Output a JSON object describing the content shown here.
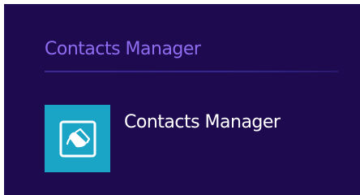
{
  "group": {
    "header": "Contacts Manager"
  },
  "apps": [
    {
      "label": "Contacts Manager",
      "icon": "contacts-manager-icon",
      "tile_color": "#1aa4c6"
    }
  ],
  "colors": {
    "background": "#1e0a4f",
    "header_text": "#8f6cf0",
    "app_text": "#ffffff"
  }
}
